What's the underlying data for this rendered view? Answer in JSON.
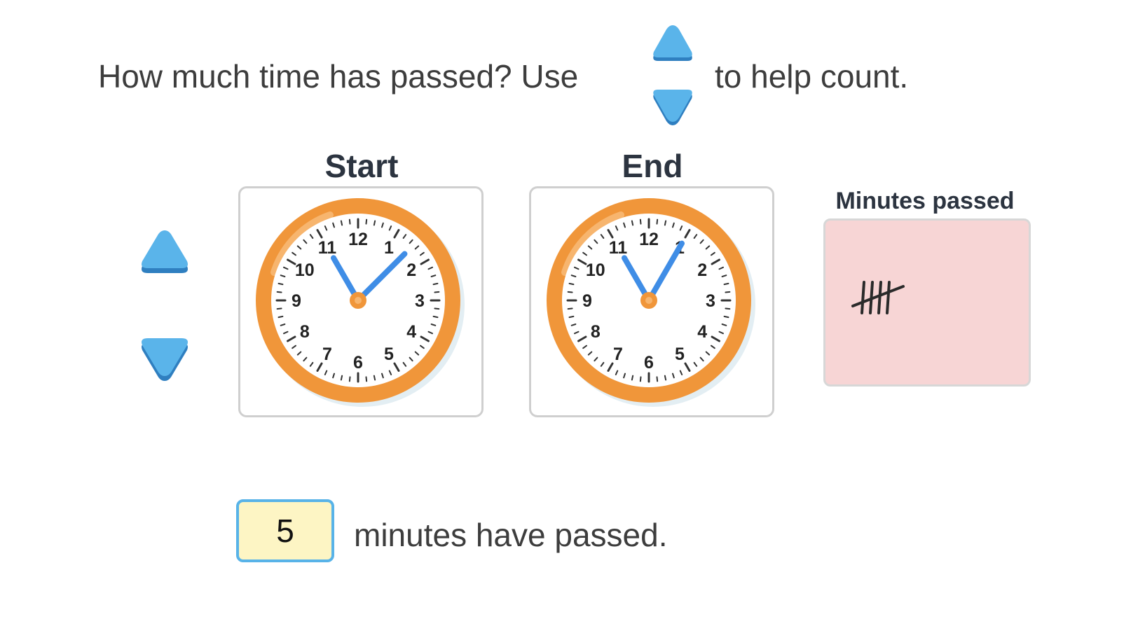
{
  "question": {
    "prefix": "How much time has passed? Use",
    "suffix": "to help count."
  },
  "clocks": {
    "start": {
      "label": "Start",
      "hour_hand_points_to": 11,
      "minute_hand_points_to": 1.5
    },
    "end": {
      "label": "End",
      "hour_hand_points_to": 11,
      "minute_hand_points_to": 1
    },
    "numerals": [
      "12",
      "1",
      "2",
      "3",
      "4",
      "5",
      "6",
      "7",
      "8",
      "9",
      "10",
      "11"
    ]
  },
  "tally": {
    "label": "Minutes passed",
    "count": 5
  },
  "answer": {
    "value": "5",
    "text": "minutes have passed."
  },
  "colors": {
    "arrow": "#4aa8e0",
    "arrow_shadow": "#2f7fc0",
    "clock_rim": "#f0963a",
    "clock_hand": "#3f8de6",
    "tally_bg": "#f7d5d5",
    "answer_bg": "#fdf5c4",
    "answer_border": "#58b3e8"
  },
  "icons": {
    "up_arrow": "triangle-up-icon",
    "down_arrow": "triangle-down-icon",
    "tally_marks": "tally-marks-icon"
  }
}
